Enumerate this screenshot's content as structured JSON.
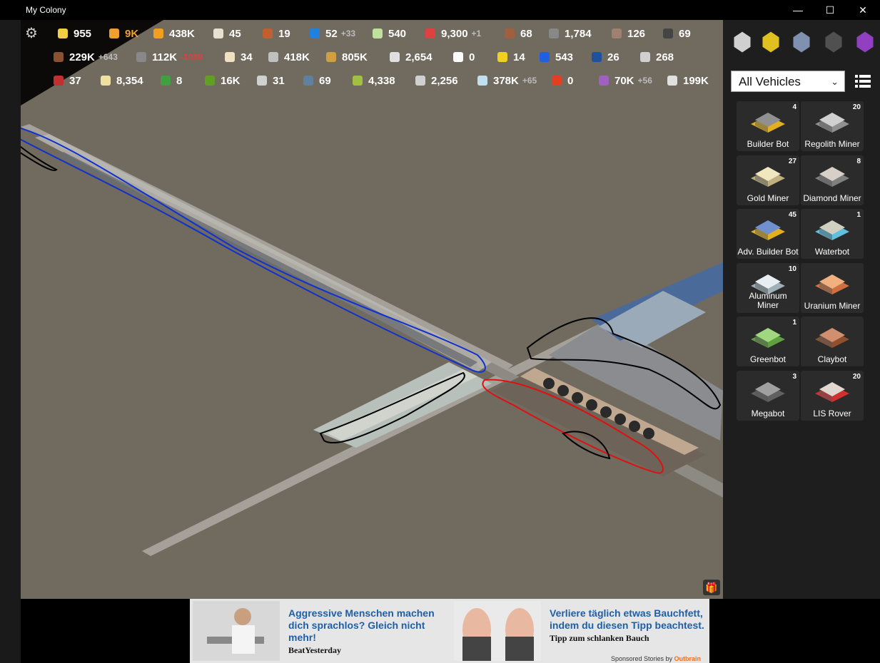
{
  "window": {
    "title": "My Colony",
    "minimize": "—",
    "maximize": "☐",
    "close": "✕"
  },
  "settings_icon": "gear-icon",
  "resources": {
    "row1": [
      {
        "id": "research",
        "icon": "bulb-icon",
        "value": "955",
        "color": "#f0d040"
      },
      {
        "id": "power",
        "icon": "lightning-icon",
        "value": "9K",
        "color": "#f0a030"
      },
      {
        "id": "money",
        "icon": "coin-icon",
        "value": "438K",
        "color": "#f0a020"
      },
      {
        "id": "regolith",
        "icon": "pile-icon",
        "value": "45",
        "color": "#e8e0d0"
      },
      {
        "id": "food",
        "icon": "drumstick-icon",
        "value": "19",
        "color": "#c06030"
      },
      {
        "id": "water",
        "icon": "drop-icon",
        "value": "52",
        "delta": "+33",
        "color": "#2080e0"
      },
      {
        "id": "cabbage",
        "icon": "cabbage-icon",
        "value": "540",
        "color": "#c0e0a0"
      },
      {
        "id": "civics",
        "icon": "civics-icon",
        "value": "9,300",
        "delta": "+1",
        "color": "#e04040"
      },
      {
        "id": "alcohol",
        "icon": "bottle-icon",
        "value": "68",
        "color": "#a06040"
      },
      {
        "id": "tires",
        "icon": "tire-icon",
        "value": "1,784",
        "color": "#888888"
      },
      {
        "id": "wood",
        "icon": "wood-icon",
        "value": "126",
        "color": "#a08070"
      },
      {
        "id": "coal",
        "icon": "coal-icon",
        "value": "69",
        "color": "#444444"
      }
    ],
    "row2": [
      {
        "id": "clay",
        "icon": "clay-icon",
        "value": "229K",
        "delta": "+643",
        "color": "#8a5030"
      },
      {
        "id": "ore",
        "icon": "ore-icon",
        "value": "112K",
        "delta": "-1080",
        "neg": true,
        "color": "#888888"
      },
      {
        "id": "cotton",
        "icon": "cotton-icon",
        "value": "34",
        "color": "#f0e0c0"
      },
      {
        "id": "steel",
        "icon": "steel-icon",
        "value": "418K",
        "color": "#c0c0c0"
      },
      {
        "id": "gold",
        "icon": "gold-icon",
        "value": "805K",
        "color": "#d0a040"
      },
      {
        "id": "aluminum",
        "icon": "aluminum-icon",
        "value": "2,654",
        "color": "#e0e0e0"
      },
      {
        "id": "diamond",
        "icon": "diamond-icon",
        "value": "0",
        "color": "#ffffff"
      },
      {
        "id": "uranium",
        "icon": "radiation-icon",
        "value": "14",
        "color": "#f0d020"
      },
      {
        "id": "microchips",
        "icon": "chip-icon",
        "value": "543",
        "color": "#2060e0"
      },
      {
        "id": "textiles",
        "icon": "textile-icon",
        "value": "26",
        "color": "#2050a0"
      },
      {
        "id": "rock",
        "icon": "rock-icon",
        "value": "268",
        "color": "#d0d0d0"
      }
    ],
    "row3": [
      {
        "id": "rugs",
        "icon": "rug-icon",
        "value": "37",
        "color": "#c03030"
      },
      {
        "id": "bread",
        "icon": "bread-icon",
        "value": "8,354",
        "color": "#f0e0a0"
      },
      {
        "id": "toys",
        "icon": "toy-icon",
        "value": "8",
        "color": "#40a040"
      },
      {
        "id": "circuits",
        "icon": "circuit-icon",
        "value": "16K",
        "color": "#60a020"
      },
      {
        "id": "robots",
        "icon": "robot-icon",
        "value": "31",
        "color": "#d0d0d0"
      },
      {
        "id": "glass",
        "icon": "glass-icon",
        "value": "69",
        "color": "#6080a0"
      },
      {
        "id": "cheese",
        "icon": "cheese-icon",
        "value": "4,338",
        "color": "#a0c040"
      },
      {
        "id": "antimatter",
        "icon": "antimatter-icon",
        "value": "2,256",
        "color": "#d0d0d0"
      },
      {
        "id": "ether",
        "icon": "cloud-icon",
        "value": "378K",
        "delta": "+65",
        "color": "#c0e0f0"
      },
      {
        "id": "fire",
        "icon": "fire-icon",
        "value": "0",
        "color": "#e04020"
      },
      {
        "id": "potion",
        "icon": "potion-icon",
        "value": "70K",
        "delta": "+56",
        "color": "#a060c0"
      },
      {
        "id": "culture",
        "icon": "bank-icon",
        "value": "199K",
        "color": "#e0e0e0"
      }
    ]
  },
  "sidebar": {
    "top_icons": [
      "rocket-icon",
      "bulldozer-icon",
      "satellite-icon",
      "crate-icon",
      "flask-icon"
    ],
    "filter": "All Vehicles",
    "vehicles": [
      {
        "name": "Builder Bot",
        "count": "4",
        "body": "#909090",
        "accent": "#e0b020"
      },
      {
        "name": "Regolith Miner",
        "count": "20",
        "body": "#d0d0d0",
        "accent": "#909090"
      },
      {
        "name": "Gold Miner",
        "count": "27",
        "body": "#f0e6c0",
        "accent": "#c0b080"
      },
      {
        "name": "Diamond Miner",
        "count": "8",
        "body": "#d8d0c8",
        "accent": "#808080"
      },
      {
        "name": "Adv. Builder Bot",
        "count": "45",
        "body": "#7090d0",
        "accent": "#e0b020"
      },
      {
        "name": "Waterbot",
        "count": "1",
        "body": "#d0d0c0",
        "accent": "#60c0e0"
      },
      {
        "name": "Aluminum Miner",
        "count": "10",
        "body": "#e8eef2",
        "accent": "#a0b0b8"
      },
      {
        "name": "Uranium Miner",
        "count": "",
        "body": "#f0b080",
        "accent": "#d07040"
      },
      {
        "name": "Greenbot",
        "count": "1",
        "body": "#a0d880",
        "accent": "#60a040"
      },
      {
        "name": "Claybot",
        "count": "",
        "body": "#d09070",
        "accent": "#905030"
      },
      {
        "name": "Megabot",
        "count": "3",
        "body": "#a0a0a0",
        "accent": "#606060"
      },
      {
        "name": "LIS Rover",
        "count": "20",
        "body": "#e0d8d0",
        "accent": "#d03030"
      }
    ]
  },
  "ads": [
    {
      "title": "Aggressive Menschen machen dich sprachlos? Gleich nicht mehr!",
      "source": "BeatYesterday"
    },
    {
      "title": "Verliere täglich etwas Bauchfett, indem du diesen Tipp beachtest.",
      "source": "Tipp zum schlanken Bauch"
    }
  ],
  "sponsored": {
    "prefix": "Sponsored Stories by ",
    "brand": "Outbrain"
  },
  "gift_icon": "gift-icon"
}
